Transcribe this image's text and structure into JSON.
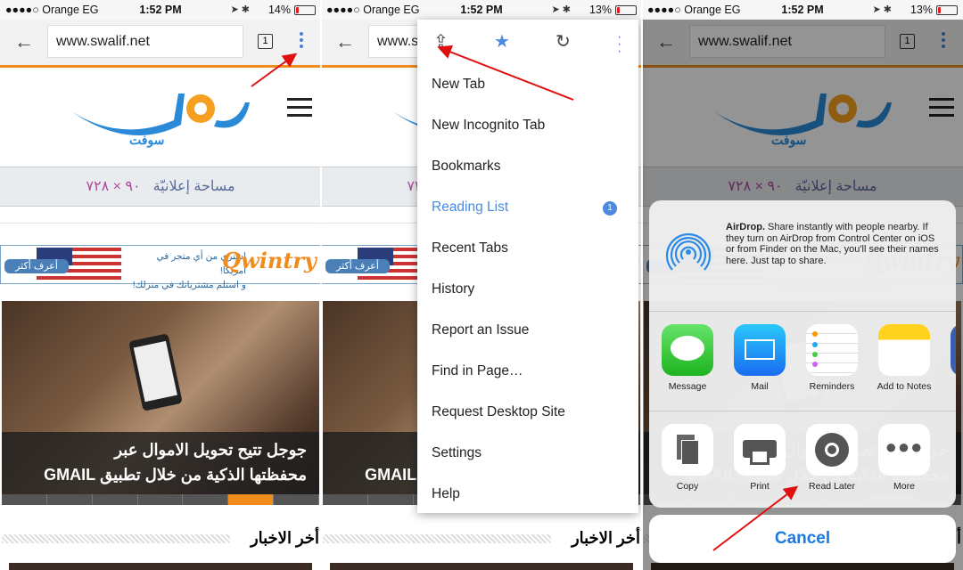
{
  "panels": [
    {
      "carrier": "●●●●○ Orange EG",
      "time": "1:52 PM",
      "battery": "14%"
    },
    {
      "carrier": "●●●●○ Orange EG",
      "time": "1:52 PM",
      "battery": "13%"
    },
    {
      "carrier": "●●●●○ Orange EG",
      "time": "1:52 PM",
      "battery": "13%"
    }
  ],
  "browser": {
    "url": "www.swalif.net",
    "tab_count": "1"
  },
  "page": {
    "ad_text": "مساحة إعلانيّة",
    "ad_size": "٩٠ × ٧٢٨",
    "banner": {
      "button": "أعرف أكثر",
      "line1": "إشتري من أي متجر في أمريكا!",
      "line2": "و استلم مشترياتك في منزلك!",
      "brand": "Qwintry"
    },
    "headline_1": "جوجل تتيح تحويل الاموال عبر",
    "headline_2": "محفظتها الذكية من خلال تطبيق GMAIL",
    "section": "أخر الاخبار",
    "logo_sub": "سوفت"
  },
  "menu": {
    "items": [
      {
        "label": "New Tab"
      },
      {
        "label": "New Incognito Tab"
      },
      {
        "label": "Bookmarks"
      },
      {
        "label": "Reading List",
        "badge": "1"
      },
      {
        "label": "Recent Tabs"
      },
      {
        "label": "History"
      },
      {
        "label": "Report an Issue"
      },
      {
        "label": "Find in Page…"
      },
      {
        "label": "Request Desktop Site"
      },
      {
        "label": "Settings"
      },
      {
        "label": "Help"
      }
    ]
  },
  "share": {
    "airdrop_title": "AirDrop.",
    "airdrop_text": " Share instantly with people nearby. If they turn on AirDrop from Control Center on iOS or from Finder on the Mac, you'll see their names here. Just tap to share.",
    "apps": [
      {
        "label": "Message"
      },
      {
        "label": "Mail"
      },
      {
        "label": "Reminders"
      },
      {
        "label": "Add to Notes"
      }
    ],
    "actions": [
      {
        "label": "Copy"
      },
      {
        "label": "Print"
      },
      {
        "label": "Read Later"
      },
      {
        "label": "More"
      }
    ],
    "cancel": "Cancel"
  },
  "colors": {
    "accent_orange": "#f08c1e",
    "link_blue": "#4a8ae0",
    "annotation_red": "#e01010"
  }
}
